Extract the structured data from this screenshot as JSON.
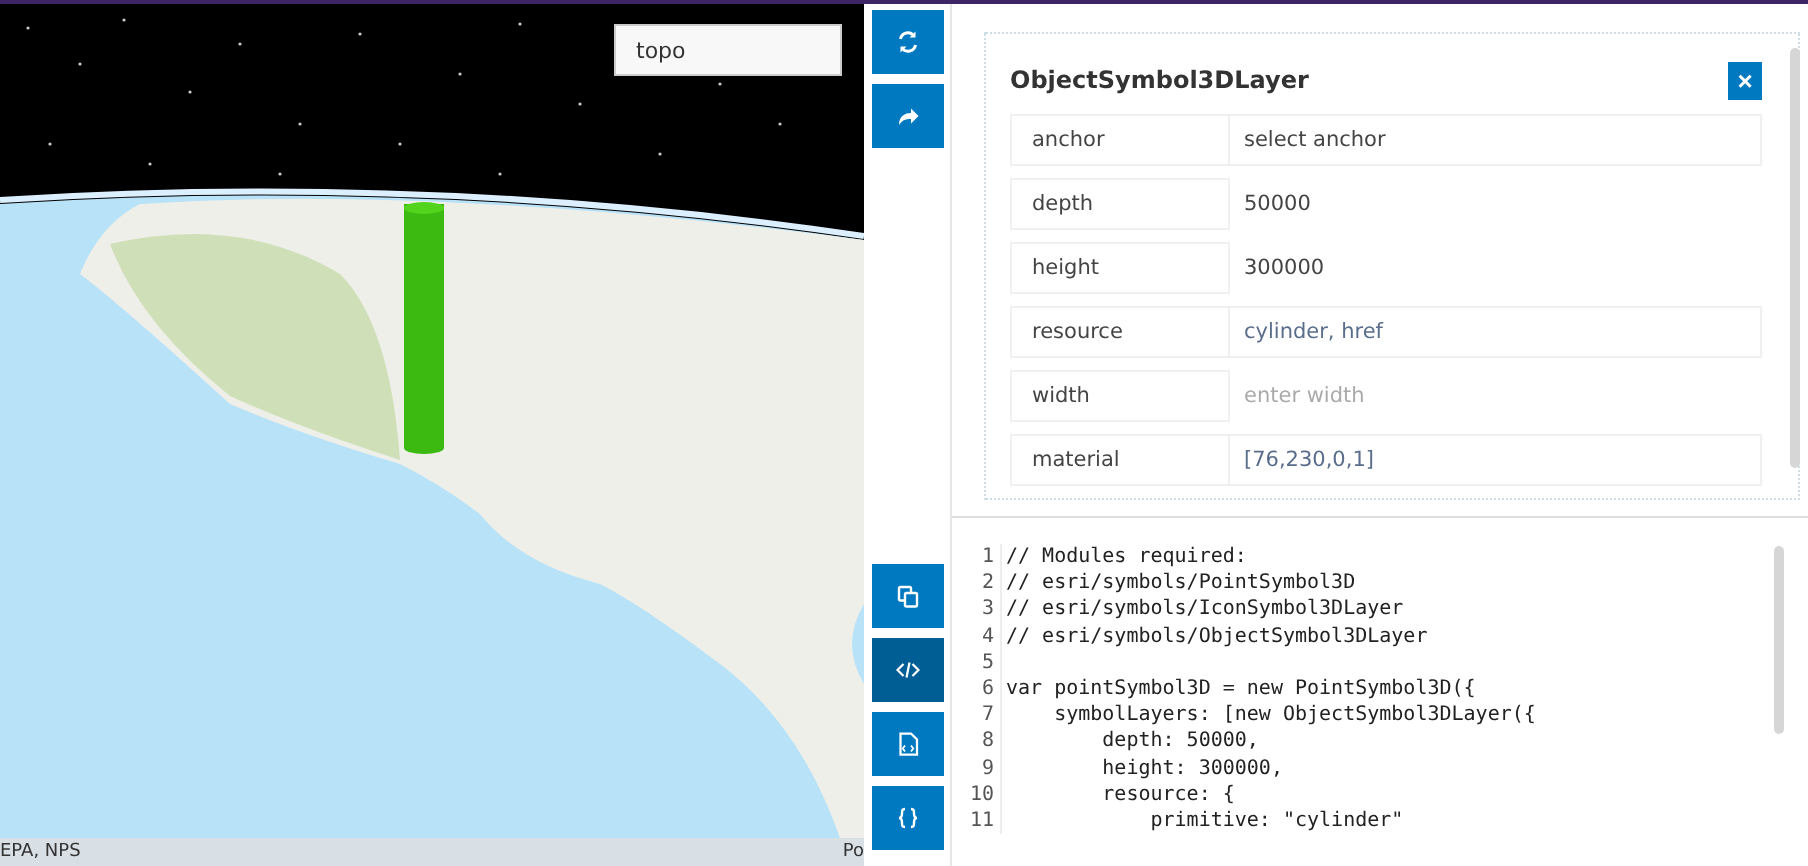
{
  "map": {
    "basemap_field": {
      "value": "topo"
    },
    "attribution": {
      "left": "EPA, NPS",
      "right": "Po"
    }
  },
  "toolbar": {
    "bottom_buttons": [
      {
        "selected": false
      },
      {
        "selected": true
      },
      {
        "selected": false
      },
      {
        "selected": false
      }
    ]
  },
  "properties_card": {
    "title": "ObjectSymbol3DLayer",
    "close": "×",
    "rows": [
      {
        "label": "anchor",
        "kind": "select",
        "value": "select anchor"
      },
      {
        "label": "depth",
        "kind": "input",
        "value": "50000"
      },
      {
        "label": "height",
        "kind": "input",
        "value": "300000"
      },
      {
        "label": "resource",
        "kind": "link",
        "value": "cylinder, href"
      },
      {
        "label": "width",
        "kind": "input",
        "placeholder": "enter width"
      },
      {
        "label": "material",
        "kind": "link",
        "value": "[76,230,0,1]"
      }
    ]
  },
  "code_editor": {
    "lines": [
      {
        "number": "1",
        "text": "// Modules required:"
      },
      {
        "number": "2",
        "text": "// esri/symbols/PointSymbol3D"
      },
      {
        "number": "3",
        "text": "// esri/symbols/IconSymbol3DLayer"
      },
      {
        "number": "4",
        "text": "// esri/symbols/ObjectSymbol3DLayer"
      },
      {
        "number": "5"
      },
      {
        "number": "6",
        "text": "var pointSymbol3D = new PointSymbol3D({"
      },
      {
        "number": "7",
        "text": "    symbolLayers: [new ObjectSymbol3DLayer({"
      },
      {
        "number": "8",
        "text": "        depth: 50000,"
      },
      {
        "number": "9",
        "text": "        height: 300000,"
      },
      {
        "number": "10",
        "text": "        resource: {"
      },
      {
        "number": "11",
        "text": "            primitive: \"cylinder\""
      }
    ]
  }
}
